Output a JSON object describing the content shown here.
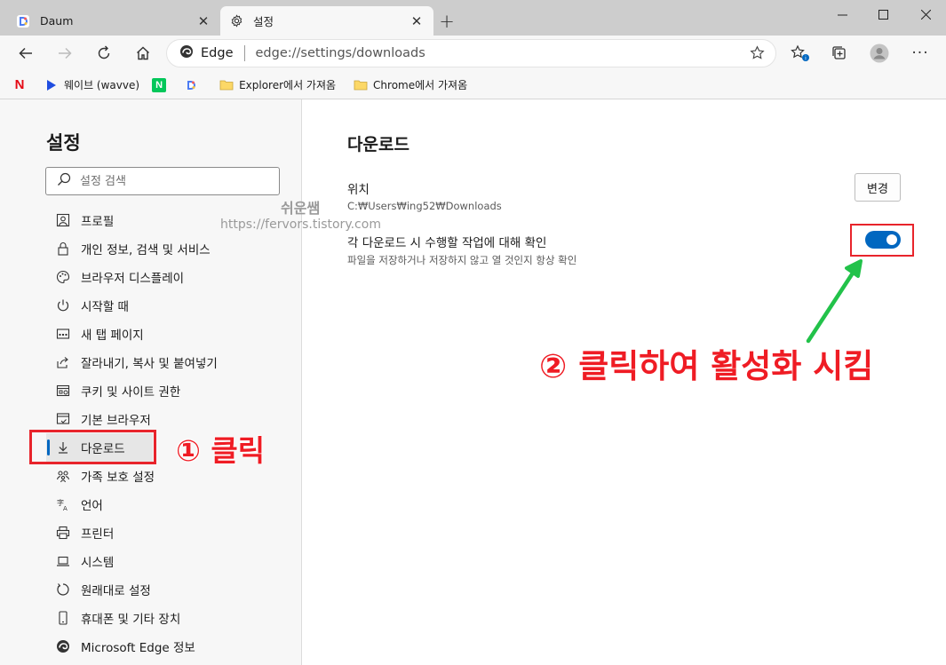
{
  "tabs": [
    {
      "title": "Daum",
      "favicon": "daum-icon"
    },
    {
      "title": "설정",
      "favicon": "gear-icon"
    }
  ],
  "toolbar": {
    "address_label": "Edge",
    "url": "edge://settings/downloads"
  },
  "bookmarks": [
    {
      "label": "",
      "icon": "netflix-icon"
    },
    {
      "label": "웨이브 (wavve)",
      "icon": "wavve-icon"
    },
    {
      "label": "",
      "icon": "naver-icon"
    },
    {
      "label": "",
      "icon": "daum-icon"
    },
    {
      "label": "Explorer에서 가져옴",
      "icon": "folder-icon"
    },
    {
      "label": "Chrome에서 가져옴",
      "icon": "folder-icon"
    }
  ],
  "sidebar": {
    "title": "설정",
    "search_placeholder": "설정 검색",
    "items": [
      {
        "label": "프로필",
        "icon": "profile-icon"
      },
      {
        "label": "개인 정보, 검색 및 서비스",
        "icon": "lock-icon"
      },
      {
        "label": "브라우저 디스플레이",
        "icon": "palette-icon"
      },
      {
        "label": "시작할 때",
        "icon": "power-icon"
      },
      {
        "label": "새 탭 페이지",
        "icon": "newtab-icon"
      },
      {
        "label": "잘라내기, 복사 및 붙여넣기",
        "icon": "share-icon"
      },
      {
        "label": "쿠키 및 사이트 권한",
        "icon": "cookie-icon"
      },
      {
        "label": "기본 브라우저",
        "icon": "browser-icon"
      },
      {
        "label": "다운로드",
        "icon": "download-icon",
        "selected": true
      },
      {
        "label": "가족 보호 설정",
        "icon": "family-icon"
      },
      {
        "label": "언어",
        "icon": "language-icon"
      },
      {
        "label": "프린터",
        "icon": "printer-icon"
      },
      {
        "label": "시스템",
        "icon": "laptop-icon"
      },
      {
        "label": "원래대로 설정",
        "icon": "reset-icon"
      },
      {
        "label": "휴대폰 및 기타 장치",
        "icon": "phone-icon"
      },
      {
        "label": "Microsoft Edge 정보",
        "icon": "edge-icon"
      }
    ]
  },
  "watermark": {
    "line1": "쉬운쌤",
    "line2": "https://fervors.tistory.com"
  },
  "main": {
    "title": "다운로드",
    "location_label": "위치",
    "location_path": "C:₩Users₩ing52₩Downloads",
    "change_button": "변경",
    "ask_label": "각 다운로드 시 수행할 작업에 대해 확인",
    "ask_desc": "파일을 저장하거나 저장하지 않고 열 것인지 항상 확인",
    "ask_enabled": true
  },
  "annotations": {
    "step1": "① 클릭",
    "step2": "② 클릭하여 활성화 시킴",
    "color": "#ef1c24"
  },
  "colors": {
    "accent": "#0067c0",
    "annotation_red": "#e8242b",
    "arrow_green": "#22c24a"
  }
}
